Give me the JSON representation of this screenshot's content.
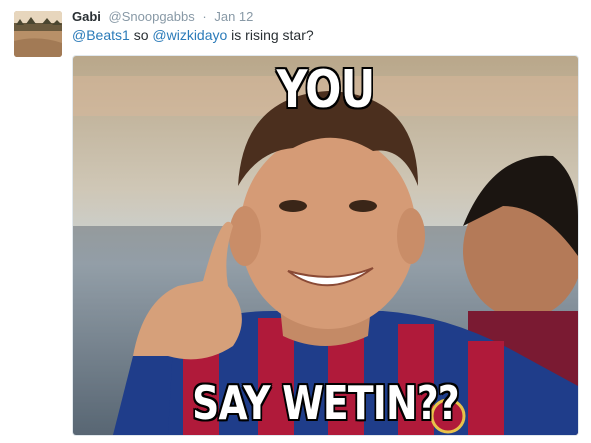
{
  "tweet": {
    "author_name": "Gabi",
    "author_handle": "@Snoopgabbs",
    "separator": "·",
    "date": "Jan 12",
    "text": {
      "mention1": "@Beats1",
      "part1": " so ",
      "mention2": "@wizkidayo",
      "part2": " is rising star?"
    },
    "meme": {
      "top_text": "YOU",
      "bottom_text": "SAY WETIN??"
    }
  },
  "colors": {
    "link": "#2b7bb9",
    "name": "#292f33",
    "muted": "#8899a6",
    "jersey_blue": "#1f3d8a",
    "jersey_red": "#b01a3a"
  }
}
